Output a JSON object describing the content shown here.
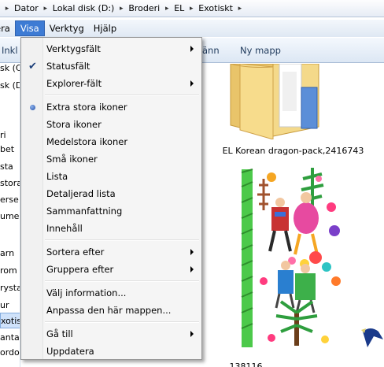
{
  "breadcrumb": [
    "Dator",
    "Lokal disk (D:)",
    "Broderi",
    "EL",
    "Exotiskt"
  ],
  "menubar": [
    {
      "name": "menu-arkiv",
      "label": "era",
      "active": false
    },
    {
      "name": "menu-visa",
      "label": "Visa",
      "active": true
    },
    {
      "name": "menu-verktyg",
      "label": "Verktyg",
      "active": false
    },
    {
      "name": "menu-hjalp",
      "label": "Hjälp",
      "active": false
    }
  ],
  "toolbar": {
    "include_label": "Inkl",
    "share_label": "änn",
    "new_folder_label": "Ny mapp"
  },
  "navpane": [
    "sk (C",
    "sk (D",
    "ri",
    "bet",
    "sta",
    "stora",
    "erse n",
    "ume",
    "arn",
    "rom",
    "rystal",
    "ur",
    "xotisk",
    "antas",
    "ordon"
  ],
  "navpane_selected": "xotisk",
  "content": {
    "folder_label": "EL Korean dragon-pack,2416743",
    "partial_label": "138116"
  },
  "visa_menu": {
    "items": [
      {
        "type": "item",
        "label": "Verktygsfält",
        "submenu": true,
        "mark": "none",
        "name": "menu-item-verktygsfalt"
      },
      {
        "type": "item",
        "label": "Statusfält",
        "submenu": false,
        "mark": "check",
        "name": "menu-item-statusfalt"
      },
      {
        "type": "item",
        "label": "Explorer-fält",
        "submenu": true,
        "mark": "none",
        "name": "menu-item-explorer-falt"
      },
      {
        "type": "sep"
      },
      {
        "type": "item",
        "label": "Extra stora ikoner",
        "submenu": false,
        "mark": "dot",
        "name": "menu-item-extra-stora-ikoner"
      },
      {
        "type": "item",
        "label": "Stora ikoner",
        "submenu": false,
        "mark": "none",
        "name": "menu-item-stora-ikoner"
      },
      {
        "type": "item",
        "label": "Medelstora ikoner",
        "submenu": false,
        "mark": "none",
        "name": "menu-item-medelstora-ikoner"
      },
      {
        "type": "item",
        "label": "Små ikoner",
        "submenu": false,
        "mark": "none",
        "name": "menu-item-sma-ikoner"
      },
      {
        "type": "item",
        "label": "Lista",
        "submenu": false,
        "mark": "none",
        "name": "menu-item-lista"
      },
      {
        "type": "item",
        "label": "Detaljerad lista",
        "submenu": false,
        "mark": "none",
        "name": "menu-item-detaljerad-lista"
      },
      {
        "type": "item",
        "label": "Sammanfattning",
        "submenu": false,
        "mark": "none",
        "name": "menu-item-sammanfattning"
      },
      {
        "type": "item",
        "label": "Innehåll",
        "submenu": false,
        "mark": "none",
        "name": "menu-item-innehall"
      },
      {
        "type": "sep"
      },
      {
        "type": "item",
        "label": "Sortera efter",
        "submenu": true,
        "mark": "none",
        "name": "menu-item-sortera-efter"
      },
      {
        "type": "item",
        "label": "Gruppera efter",
        "submenu": true,
        "mark": "none",
        "name": "menu-item-gruppera-efter"
      },
      {
        "type": "sep"
      },
      {
        "type": "item",
        "label": "Välj information...",
        "submenu": false,
        "mark": "none",
        "name": "menu-item-valj-information"
      },
      {
        "type": "item",
        "label": "Anpassa den här mappen...",
        "submenu": false,
        "mark": "none",
        "name": "menu-item-anpassa-mappen"
      },
      {
        "type": "sep"
      },
      {
        "type": "item",
        "label": "Gå till",
        "submenu": true,
        "mark": "none",
        "name": "menu-item-ga-till"
      },
      {
        "type": "item",
        "label": "Uppdatera",
        "submenu": false,
        "mark": "none",
        "name": "menu-item-uppdatera"
      }
    ]
  }
}
